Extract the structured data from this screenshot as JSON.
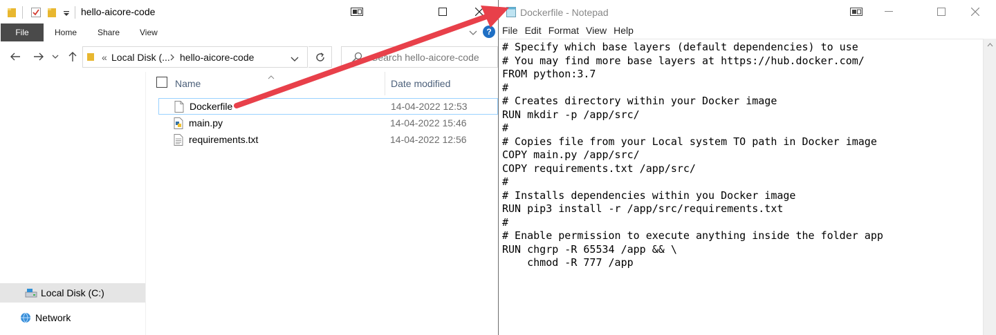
{
  "explorer": {
    "title": "hello-aicore-code",
    "ribbon_tabs": [
      "File",
      "Home",
      "Share",
      "View"
    ],
    "breadcrumb": {
      "overflow": "«",
      "parent": "Local Disk (...",
      "current": "hello-aicore-code"
    },
    "search_placeholder": "Search hello-aicore-code",
    "columns": {
      "name": "Name",
      "date": "Date modified"
    },
    "files": [
      {
        "name": "Dockerfile",
        "date": "14-04-2022 12:53",
        "icon": "blank-file-icon",
        "selected": true
      },
      {
        "name": "main.py",
        "date": "14-04-2022 15:46",
        "icon": "python-file-icon",
        "selected": false
      },
      {
        "name": "requirements.txt",
        "date": "14-04-2022 12:56",
        "icon": "text-file-icon",
        "selected": false
      }
    ],
    "nav": [
      {
        "label": "Local Disk (C:)",
        "icon": "drive-icon",
        "selected": true
      },
      {
        "label": "Network",
        "icon": "network-icon",
        "selected": false
      }
    ],
    "help_glyph": "?"
  },
  "notepad": {
    "title": "Dockerfile - Notepad",
    "menu": [
      "File",
      "Edit",
      "Format",
      "View",
      "Help"
    ],
    "content": "# Specify which base layers (default dependencies) to use\n# You may find more base layers at https://hub.docker.com/\nFROM python:3.7\n#\n# Creates directory within your Docker image\nRUN mkdir -p /app/src/\n#\n# Copies file from your Local system TO path in Docker image\nCOPY main.py /app/src/\nCOPY requirements.txt /app/src/\n#\n# Installs dependencies within you Docker image\nRUN pip3 install -r /app/src/requirements.txt\n#\n# Enable permission to execute anything inside the folder app\nRUN chgrp -R 65534 /app && \\\n    chmod -R 777 /app"
  },
  "colors": {
    "arrow": "#e8404a",
    "selection_border": "#99d1ff",
    "nav_selected": "#e5e5e5",
    "help_blue": "#1f6fc4"
  }
}
